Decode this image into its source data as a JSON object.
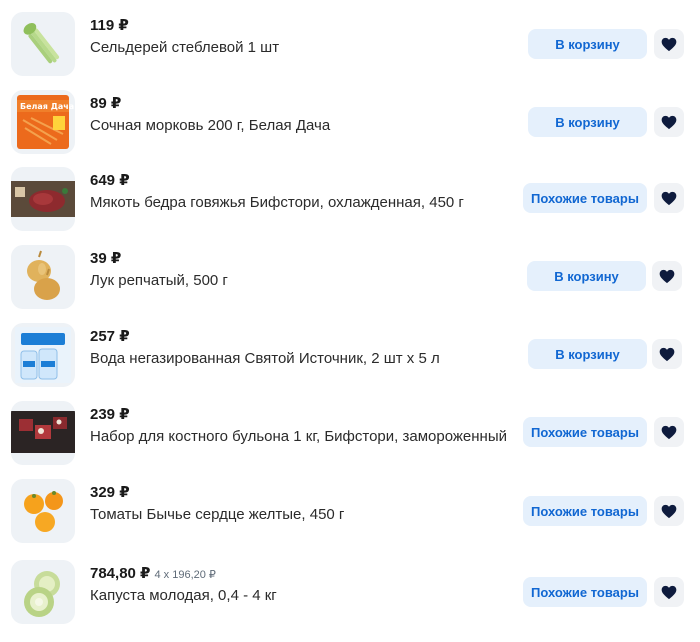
{
  "items": [
    {
      "price": "119 ₽",
      "unit_price": "",
      "title": "Сельдерей стеблевой 1 шт",
      "action": "В корзину",
      "action_type": "cart",
      "image": "celery"
    },
    {
      "price": "89 ₽",
      "unit_price": "",
      "title": "Сочная морковь 200 г, Белая Дача",
      "action": "В корзину",
      "action_type": "cart",
      "image": "carrot-pack",
      "pack_text": "Белая Дача"
    },
    {
      "price": "649 ₽",
      "unit_price": "",
      "title": "Мякоть бедра говяжья Бифстори, охлажденная, 450 г",
      "action": "Похожие товары",
      "action_type": "similar",
      "image": "beef"
    },
    {
      "price": "39 ₽",
      "unit_price": "",
      "title": "Лук репчатый, 500 г",
      "action": "В корзину",
      "action_type": "cart",
      "image": "onion"
    },
    {
      "price": "257 ₽",
      "unit_price": "",
      "title": "Вода негазированная Святой Источник, 2 шт х 5 л",
      "action": "В корзину",
      "action_type": "cart",
      "image": "water"
    },
    {
      "price": "239 ₽",
      "unit_price": "",
      "title": "Набор для костного бульона 1 кг, Бифстори, замороженный",
      "action": "Похожие товары",
      "action_type": "similar",
      "image": "bones"
    },
    {
      "price": "329 ₽",
      "unit_price": "",
      "title": "Томаты Бычье сердце желтые, 450 г",
      "action": "Похожие товары",
      "action_type": "similar",
      "image": "yellow-tomatoes"
    },
    {
      "price": "784,80 ₽",
      "unit_price": "4 x 196,20 ₽",
      "title": "Капуста молодая, 0,4 - 4 кг",
      "action": "Похожие товары",
      "action_type": "similar",
      "image": "cabbage"
    }
  ],
  "favorite_icon": "heart-icon",
  "colors": {
    "button_bg": "#e5f0fc",
    "button_text": "#1167d2",
    "heart": "#0e1b3d"
  }
}
